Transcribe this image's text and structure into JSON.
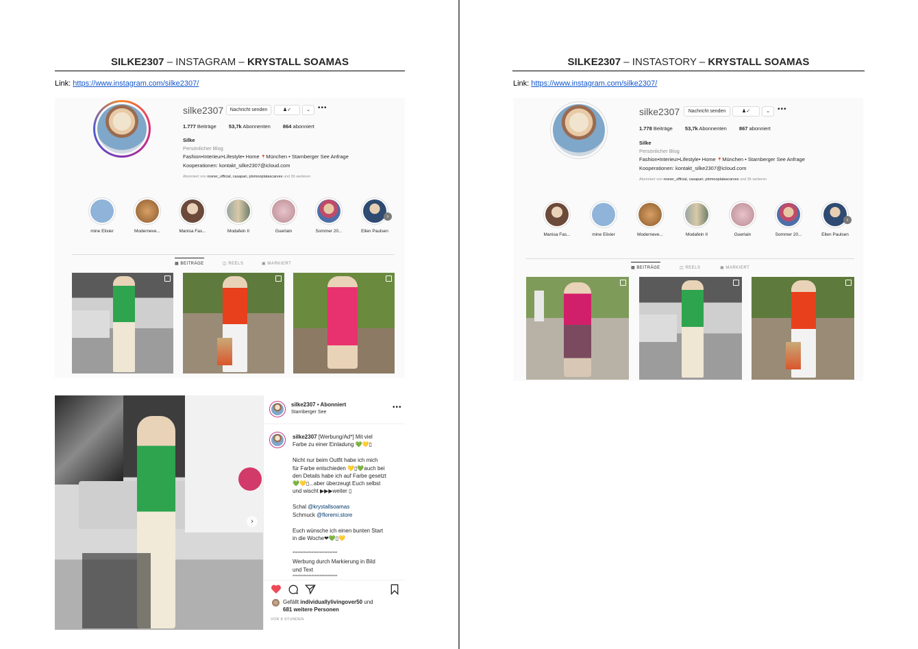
{
  "left": {
    "title": {
      "bold1": "SILKE2307",
      "mid": " – INSTAGRAM – ",
      "bold2": "KRYSTALL SOAMAS"
    },
    "link_label": "Link: ",
    "link_url": "https://www.instagram.com/silke2307/",
    "profile": {
      "username": "silke2307",
      "message_button": "Nachricht senden",
      "posts": "1.777",
      "posts_label": " Beiträge",
      "followers": "53,7k",
      "followers_label": " Abonnenten",
      "following": "864",
      "following_label": " abonniert",
      "name": "Silke",
      "category": "Persönlicher Blog",
      "bio_line1": "Fashion•Interieur•Lifestyle• Home ",
      "bio_pin": "📍",
      "bio_line1b": "München • Starnberger See Anfrage",
      "bio_line2": "Kooperationen: kontakt_silke2307@icloud.com",
      "followed_prefix": "Abonniert von ",
      "followed_names": "rosner_official, casapari, plomooplatascarves",
      "followed_suffix": " und 36 weiteren"
    },
    "highlights": [
      "mine Elixier",
      "Moderneve...",
      "Manisa Fas...",
      "Modafein II",
      "Guerlain",
      "Sommer 20...",
      "Ellen Paulsen"
    ],
    "tabs": [
      "BEITRÄGE",
      "REELS",
      "MARKIERT"
    ],
    "post": {
      "username": "silke2307",
      "follow_state": " • Abonniert",
      "location": "Starnberger See",
      "caption_user": "silke2307",
      "caption_l1": " [Werbung/Ad*] Mit viel",
      "caption_l2": "Farbe zu einer Einladung 💚💛▯",
      "p2_l1": "Nicht nur beim Outfit habe ich mich",
      "p2_l2": "für Farbe entschieden 💛▯💚auch bei",
      "p2_l3": "den Details habe ich auf Farbe gesetzt",
      "p2_l4": "💚💛▯...aber überzeugt Euch selbst",
      "p2_l5": "und wischt ▶▶▶weiter ▯",
      "p3_l1a": "Schal ",
      "p3_l1b": "@krystallsoamas",
      "p3_l2a": "Schmuck ",
      "p3_l2b": "@floremi.store",
      "p4_l1": "Euch wünsche ich einen bunten Start",
      "p4_l2": "in die Woche❤💚▯💛",
      "stars": "****************************",
      "p5_l1": "Werbung durch Markierung in Bild",
      "p5_l2": "und Text",
      "likes_prefix": "Gefällt ",
      "likes_user": "individuallylivingover50",
      "likes_mid": " und",
      "likes_more": "681 weitere Personen",
      "time": "VOR 8 STUNDEN"
    }
  },
  "right": {
    "title": {
      "bold1": "SILKE2307",
      "mid": " – INSTASTORY – ",
      "bold2": "KRYSTALL SOAMAS"
    },
    "link_label": "Link: ",
    "link_url": "https://www.instagram.com/silke2307/",
    "profile": {
      "username": "silke2307",
      "message_button": "Nachricht senden",
      "posts": "1.778",
      "posts_label": " Beiträge",
      "followers": "53,7k",
      "followers_label": " Abonnenten",
      "following": "867",
      "following_label": " abonniert",
      "name": "Silke",
      "category": "Persönlicher Blog",
      "bio_line1": "Fashion•Interieur•Lifestyle• Home ",
      "bio_pin": "📍",
      "bio_line1b": "München • Starnberger See Anfrage",
      "bio_line2": "Kooperationen: kontakt_silke2307@icloud.com",
      "followed_prefix": "Abonniert von ",
      "followed_names": "rosner_official, casapari, plomooplatascarves",
      "followed_suffix": " und 36 weiteren"
    },
    "highlights": [
      "Manisa Fas...",
      "mine Elixier",
      "Moderneve...",
      "Modafein II",
      "Guerlain",
      "Sommer 20...",
      "Ellen Paulsen"
    ],
    "tabs": [
      "BEITRÄGE",
      "REELS",
      "MARKIERT"
    ]
  }
}
